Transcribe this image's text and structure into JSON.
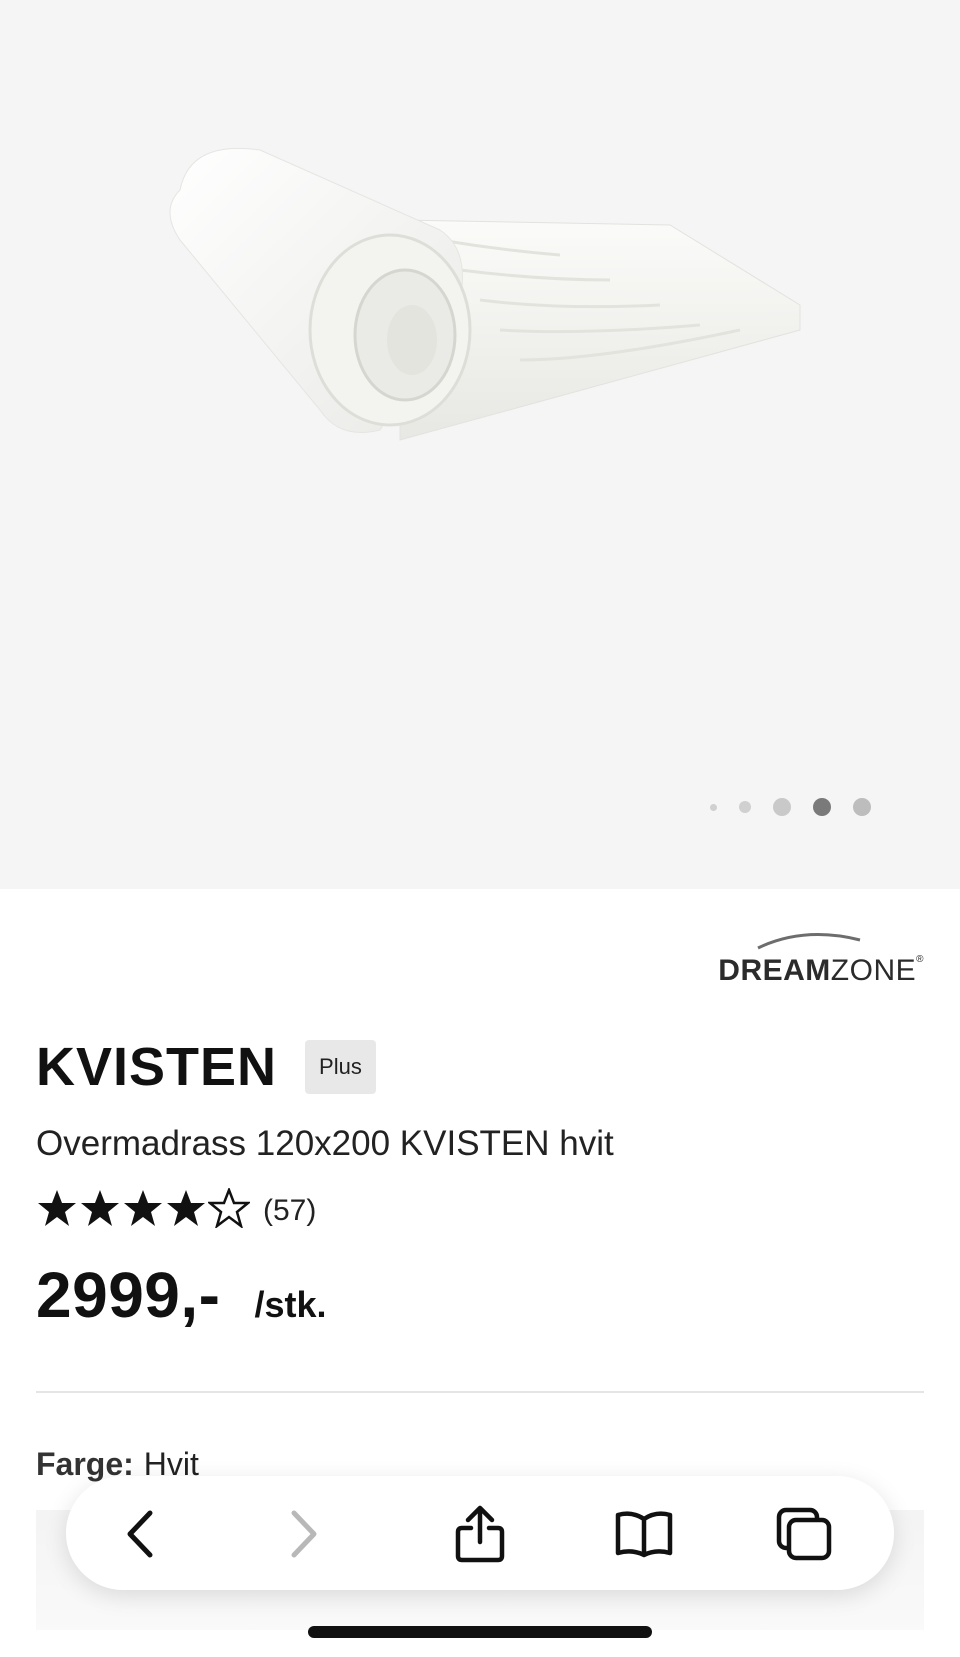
{
  "gallery": {
    "image_alt": "Rolled white mattress topper",
    "slide_count": 5,
    "active_slide": 4
  },
  "brand": {
    "name_bold": "DREAM",
    "name_regular": "ZONE",
    "mark": "®"
  },
  "product": {
    "title": "KVISTEN",
    "badge": "Plus",
    "subtitle": "Overmadrass 120x200 KVISTEN hvit",
    "rating": 4,
    "rating_max": 5,
    "review_count": "(57)",
    "price": "2999,-",
    "unit": "/stk."
  },
  "color": {
    "label": "Farge:",
    "value": "Hvit"
  },
  "toolbar": {
    "back_icon": "chevron-left-icon",
    "forward_icon": "chevron-right-icon",
    "share_icon": "share-icon",
    "bookmarks_icon": "book-icon",
    "tabs_icon": "tabs-icon"
  },
  "colors": {
    "gallery_bg": "#f5f5f5",
    "active_dot": "#7a7a7a",
    "text": "#111111",
    "badge_bg": "#e8e8e8"
  }
}
